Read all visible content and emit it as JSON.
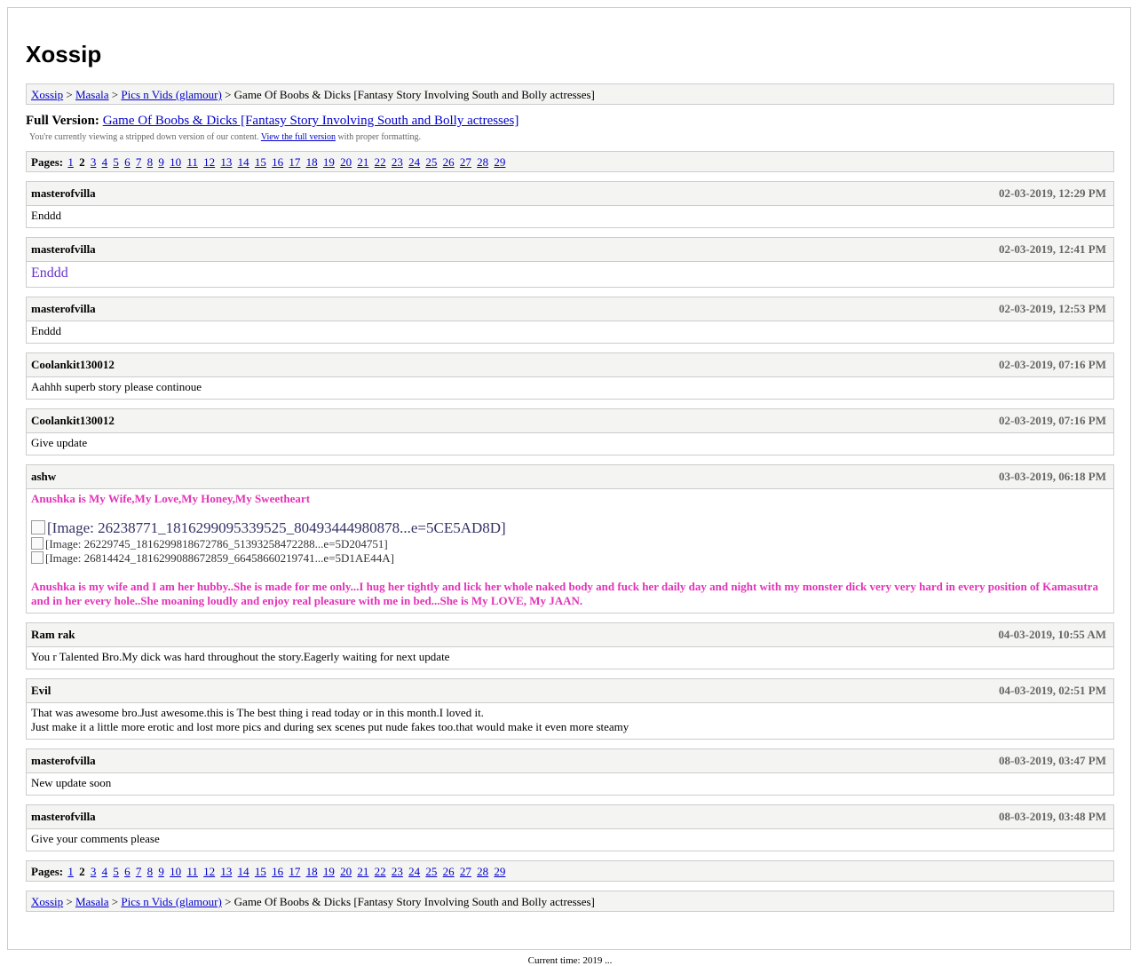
{
  "site_title": "Xossip",
  "breadcrumb": {
    "items": [
      "Xossip",
      "Masala",
      "Pics n Vids (glamour)"
    ],
    "separator": ">",
    "current": "Game Of Boobs & Dicks [Fantasy Story Involving South and Bolly actresses]"
  },
  "full_version": {
    "label": "Full Version:",
    "link_text": "Game Of Boobs & Dicks [Fantasy Story Involving South and Bolly actresses]",
    "note_before": "You're currently viewing a stripped down version of our content.",
    "note_link": "View the full version",
    "note_after": "with proper formatting."
  },
  "pagination": {
    "label": "Pages:",
    "current": "2",
    "pages": [
      "1",
      "2",
      "3",
      "4",
      "5",
      "6",
      "7",
      "8",
      "9",
      "10",
      "11",
      "12",
      "13",
      "14",
      "15",
      "16",
      "17",
      "18",
      "19",
      "20",
      "21",
      "22",
      "23",
      "24",
      "25",
      "26",
      "27",
      "28",
      "29"
    ]
  },
  "posts": [
    {
      "author": "masterofvilla",
      "date": "02-03-2019, 12:29 PM",
      "body": "Enddd"
    },
    {
      "author": "masterofvilla",
      "date": "02-03-2019, 12:41 PM",
      "body": "Enddd"
    },
    {
      "author": "masterofvilla",
      "date": "02-03-2019, 12:53 PM",
      "body": "Enddd"
    },
    {
      "author": "Coolankit130012",
      "date": "02-03-2019, 07:16 PM",
      "body": "Aahhh superb story please continoue"
    },
    {
      "author": "Coolankit130012",
      "date": "02-03-2019, 07:16 PM",
      "body": "Give update"
    },
    {
      "author": "ashw",
      "date": "03-03-2019, 06:18 PM",
      "signature_top": "Anushka is My Wife,My Love,My Honey,My Sweetheart",
      "images": [
        "[Image: 26238771_1816299095339525_80493444980878...e=5CE5AD8D]",
        "[Image: 26229745_1816299818672786_51393258472288...e=5D204751]",
        "[Image: 26814424_1816299088672859_66458660219741...e=5D1AE44A]"
      ],
      "signature_bottom": "Anushka is my wife and I am her hubby..She is made for me only...I hug her tightly and lick her whole naked body and fuck her daily day and night with my monster dick very very hard in every position of Kamasutra and in her every hole..She moaning loudly and enjoy real pleasure with me in bed...She is My LOVE, My JAAN."
    },
    {
      "author": "Ram rak",
      "date": "04-03-2019, 10:55 AM",
      "body": "You r Talented Bro.My dick was hard throughout the story.Eagerly waiting for next update"
    },
    {
      "author": "Evil",
      "date": "04-03-2019, 02:51 PM",
      "body": "That was awesome bro.Just awesome.this is The best thing i read today or in this month.I loved it.",
      "body_line2": "Just make it a little more erotic and lost more pics and during sex scenes put nude fakes too.that would make it even more steamy"
    },
    {
      "author": "masterofvilla",
      "date": "08-03-2019, 03:47 PM",
      "body": "New update soon"
    },
    {
      "author": "masterofvilla",
      "date": "08-03-2019, 03:48 PM",
      "body": "Give your comments please"
    }
  ],
  "footer": {
    "copyright": "Current time: 2019 ..."
  },
  "colors": {
    "link": "#0000cc",
    "box_bg": "#f4f4f2",
    "border": "#cccccc",
    "pink_signature": "#e233b7",
    "purple_text": "#6633cc"
  }
}
